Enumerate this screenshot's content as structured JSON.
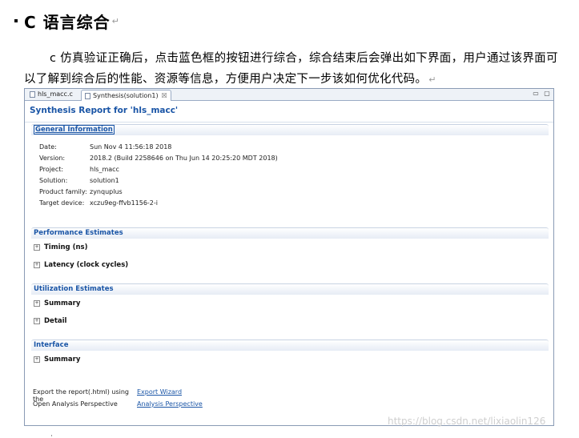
{
  "doc": {
    "heading": "C 语言综合",
    "pilcrow": "↵",
    "paragraph": "c 仿真验证正确后，点击蓝色框的按钮进行综合，综合结束后会弹出如下界面，用户通过该界面可以了解到综合后的性能、资源等信息，方便用户决定下一步该如何优化代码。"
  },
  "window": {
    "tabs": [
      {
        "label": "hls_macc.c"
      },
      {
        "label": "Synthesis(solution1)",
        "close": "☒"
      }
    ],
    "controls": [
      "▭",
      "▢"
    ],
    "report_title": "Synthesis Report for 'hls_macc'",
    "sections": {
      "general": {
        "header": "General Information",
        "rows": [
          {
            "k": "Date:",
            "v": "Sun Nov 4 11:56:18 2018"
          },
          {
            "k": "Version:",
            "v": "2018.2 (Build 2258646 on Thu Jun 14 20:25:20 MDT 2018)"
          },
          {
            "k": "Project:",
            "v": "hls_macc"
          },
          {
            "k": "Solution:",
            "v": "solution1"
          },
          {
            "k": "Product family:",
            "v": "zynquplus"
          },
          {
            "k": "Target device:",
            "v": "xczu9eg-ffvb1156-2-i"
          }
        ]
      },
      "performance": {
        "header": "Performance Estimates",
        "items": [
          "Timing (ns)",
          "Latency (clock cycles)"
        ]
      },
      "utilization": {
        "header": "Utilization Estimates",
        "items": [
          "Summary",
          "Detail"
        ]
      },
      "interface": {
        "header": "Interface",
        "items": [
          "Summary"
        ]
      }
    },
    "links": [
      {
        "k": "Export the report(.html) using the",
        "v": "Export Wizard"
      },
      {
        "k": "Open Analysis Perspective",
        "v": "Analysis Perspective"
      }
    ]
  },
  "watermark": "https://blog.csdn.net/lixiaolin126"
}
